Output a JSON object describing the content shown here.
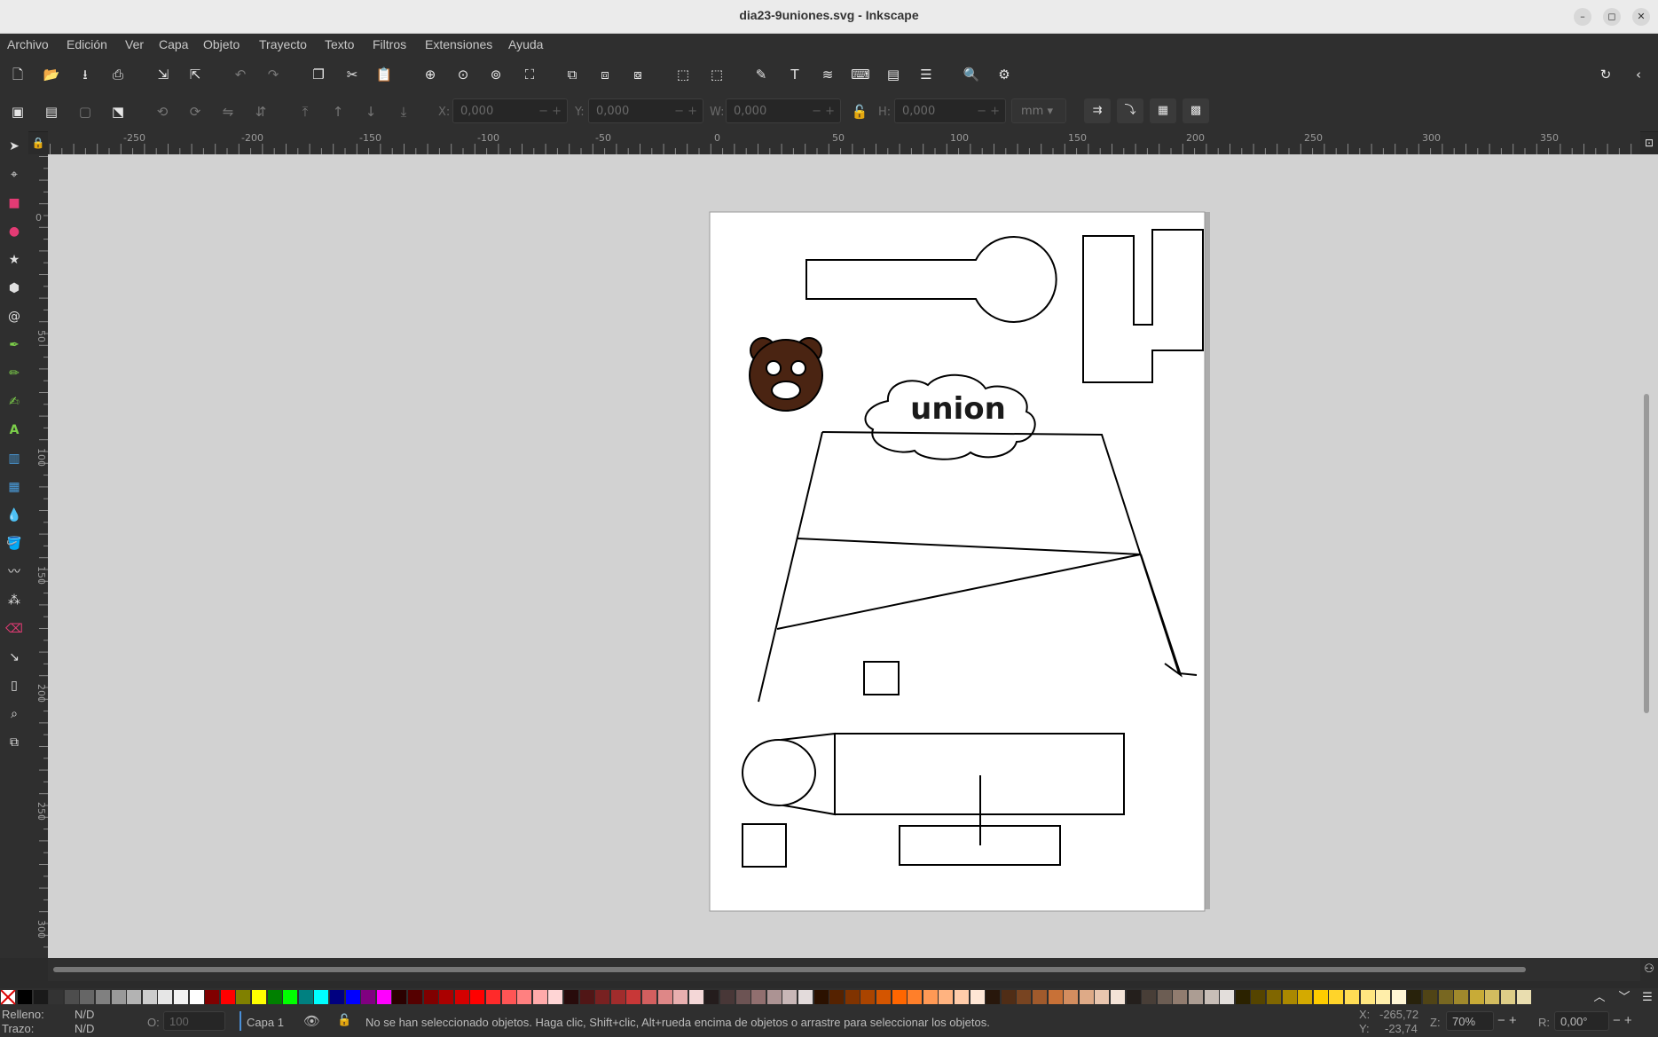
{
  "window": {
    "title": "dia23-9uniones.svg - Inkscape",
    "minimize": "–",
    "restore": "◻",
    "close": "✕"
  },
  "menu": [
    "Archivo",
    "Edición",
    "Ver",
    "Capa",
    "Objeto",
    "Trayecto",
    "Texto",
    "Filtros",
    "Extensiones",
    "Ayuda"
  ],
  "toolbar2": {
    "x_label": "X:",
    "x_value": "0,000",
    "y_label": "Y:",
    "y_value": "0,000",
    "w_label": "W:",
    "w_value": "0,000",
    "h_label": "H:",
    "h_value": "0,000",
    "unit": "mm"
  },
  "ruler_h": [
    "-250",
    "-200",
    "-150",
    "-100",
    "-50",
    "0",
    "50",
    "100",
    "150",
    "200",
    "250",
    "300",
    "350"
  ],
  "ruler_v": [
    "0",
    "50",
    "100",
    "150",
    "200",
    "250",
    "300"
  ],
  "canvas": {
    "union_text": "union",
    "bear_fill": "#4a2412"
  },
  "status": {
    "fill_label": "Relleno:",
    "fill_value": "N/D",
    "stroke_label": "Trazo:",
    "stroke_value": "N/D",
    "opacity_label": "O:",
    "opacity_value": "100",
    "layer": "Capa 1",
    "message": "No se han seleccionado objetos. Haga clic, Shift+clic, Alt+rueda encima de objetos o arrastre para seleccionar los objetos.",
    "x_label": "X:",
    "x_value": "-265,72",
    "y_label": "Y:",
    "y_value": "-23,74",
    "zoom_label": "Z:",
    "zoom_value": "70%",
    "rotation_label": "R:",
    "rotation_value": "0,00°"
  },
  "colors": {
    "accent": "#4a90d9",
    "page": "#ffffff",
    "desk": "#d2d2d2"
  }
}
